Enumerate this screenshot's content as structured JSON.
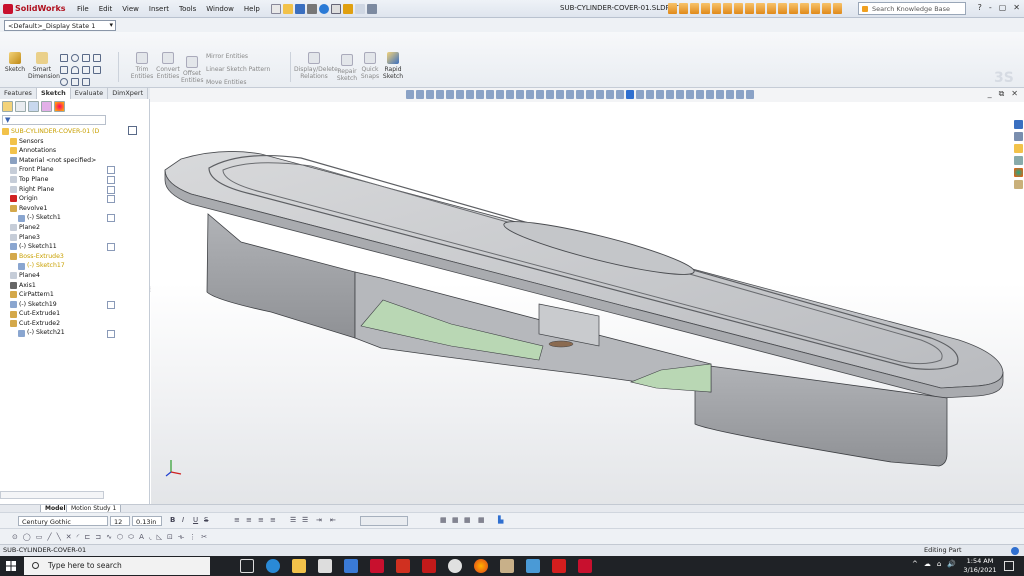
{
  "app": {
    "name": "SolidWorks",
    "doc_title": "SUB-CYLINDER-COVER-01.SLDPRT *",
    "menu": [
      "File",
      "Edit",
      "View",
      "Insert",
      "Tools",
      "Window",
      "Help"
    ],
    "search_placeholder": "Search Knowledge Base",
    "window_controls": [
      "?",
      "-",
      "▢",
      "✕"
    ]
  },
  "config": {
    "display_state": "<Default>_Display State 1"
  },
  "command_manager": {
    "sketch": "Sketch",
    "smart_dimension": [
      "Smart",
      "Dimension"
    ],
    "trim": [
      "Trim",
      "Entities"
    ],
    "convert": [
      "Convert",
      "Entities"
    ],
    "offset": [
      "Offset",
      "Entities"
    ],
    "mirror": "Mirror Entities",
    "linear_pattern": "Linear Sketch Pattern",
    "move": "Move Entities",
    "relations": [
      "Display/Delete",
      "Relations"
    ],
    "repair": [
      "Repair",
      "Sketch"
    ],
    "quick_snaps": [
      "Quick",
      "Snaps"
    ],
    "rapid": [
      "Rapid",
      "Sketch"
    ]
  },
  "tabs": [
    "Features",
    "Sketch",
    "Evaluate",
    "DimXpert"
  ],
  "active_tab": "Sketch",
  "feature_tree": [
    {
      "label": "SUB-CYLINDER-COVER-01  (D",
      "indent": 0,
      "type": "part",
      "warn": true
    },
    {
      "label": "Sensors",
      "indent": 1,
      "type": "sensor"
    },
    {
      "label": "Annotations",
      "indent": 1,
      "type": "annot"
    },
    {
      "label": "Material <not specified>",
      "indent": 1,
      "type": "material"
    },
    {
      "label": "Front Plane",
      "indent": 1,
      "type": "plane"
    },
    {
      "label": "Top Plane",
      "indent": 1,
      "type": "plane"
    },
    {
      "label": "Right Plane",
      "indent": 1,
      "type": "plane"
    },
    {
      "label": "Origin",
      "indent": 1,
      "type": "origin"
    },
    {
      "label": "Revolve1",
      "indent": 1,
      "type": "feature"
    },
    {
      "label": "(-) Sketch1",
      "indent": 2,
      "type": "sketch"
    },
    {
      "label": "Plane2",
      "indent": 1,
      "type": "plane"
    },
    {
      "label": "Plane3",
      "indent": 1,
      "type": "plane"
    },
    {
      "label": "(-) Sketch11",
      "indent": 1,
      "type": "sketch"
    },
    {
      "label": "Boss-Extrude3",
      "indent": 1,
      "type": "feature",
      "warn": true
    },
    {
      "label": "(-) Sketch17",
      "indent": 2,
      "type": "sketch",
      "warn": true
    },
    {
      "label": "Plane4",
      "indent": 1,
      "type": "plane"
    },
    {
      "label": "Axis1",
      "indent": 1,
      "type": "axis"
    },
    {
      "label": "CirPattern1",
      "indent": 1,
      "type": "feature"
    },
    {
      "label": "(-) Sketch19",
      "indent": 1,
      "type": "sketch"
    },
    {
      "label": "Cut-Extrude1",
      "indent": 1,
      "type": "feature"
    },
    {
      "label": "Cut-Extrude2",
      "indent": 1,
      "type": "feature"
    },
    {
      "label": "(-) Sketch21",
      "indent": 2,
      "type": "sketch"
    }
  ],
  "filter_icon": "filter-icon",
  "model_tabs": [
    "Model",
    "Motion Study 1"
  ],
  "format": {
    "font": "Century Gothic",
    "size": "12",
    "height": "0.13in"
  },
  "status": {
    "left": "SUB-CYLINDER-COVER-01",
    "right": "Editing Part"
  },
  "taskbar": {
    "search_placeholder": "Type here to search",
    "time": "1:54 AM",
    "date": "3/16/2021",
    "tray": [
      "^",
      "☁",
      "🔊"
    ]
  },
  "colors": {
    "solidworks_red": "#c8102e",
    "model_grey": "#c9cbce",
    "section_green": "#b9d7b4",
    "accent_blue": "#2f6fd0"
  }
}
